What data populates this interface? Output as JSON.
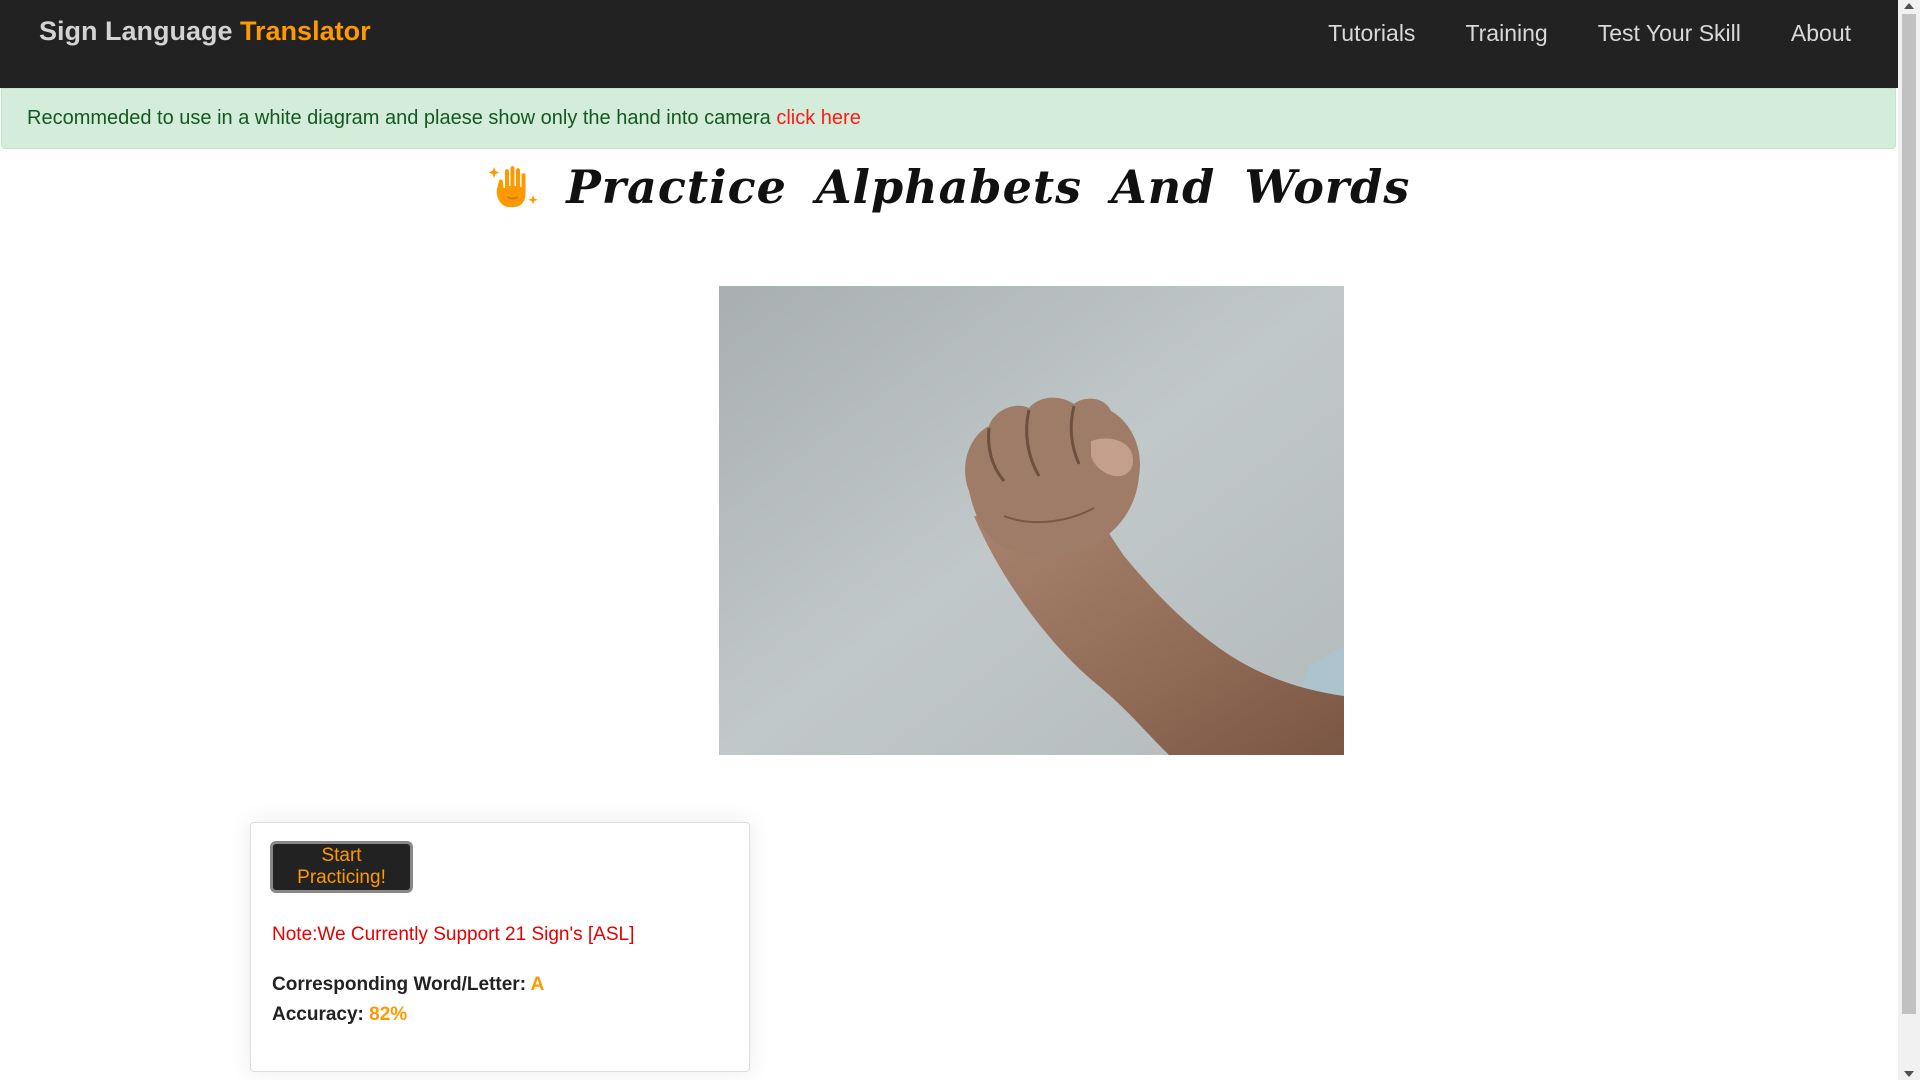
{
  "navbar": {
    "brand_primary": "Sign Language",
    "brand_accent": "Translator",
    "links": [
      {
        "label": "Tutorials"
      },
      {
        "label": "Training"
      },
      {
        "label": "Test Your Skill"
      },
      {
        "label": "About"
      }
    ]
  },
  "alert": {
    "message": "Recommeded to use in a white diagram and plaese show only the hand into camera",
    "link_label": "click here"
  },
  "heading": {
    "icon": "waving-hand-sparkle-icon",
    "title": "Practice Alphabets And Words"
  },
  "camera": {
    "icon": "camera-feed-fist-hand"
  },
  "card": {
    "button_label": "Start Practicing!",
    "note": "Note:We Currently Support 21 Sign's [ASL]",
    "letter_label": "Corresponding Word/Letter:",
    "letter_value": "A",
    "accuracy_label": "Accuracy:",
    "accuracy_value": "82%"
  },
  "colors": {
    "navbar_bg": "#222222",
    "accent": "#ff9900",
    "alert_bg": "#d4edda",
    "alert_text": "#155724",
    "link_red": "#ff1a1a",
    "note_red": "#e60000"
  }
}
